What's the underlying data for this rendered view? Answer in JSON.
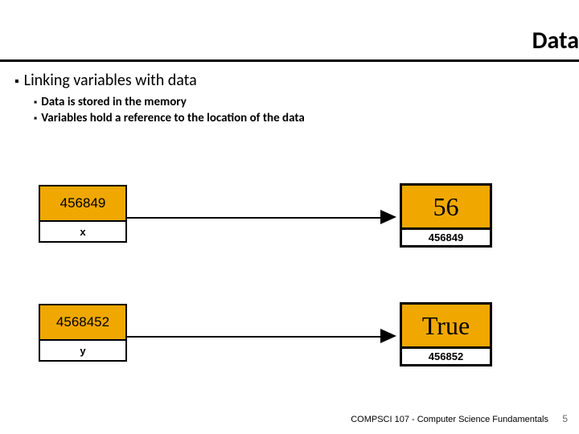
{
  "title": "Data",
  "bullets": {
    "main": "Linking variables with data",
    "sub1": "Data is stored in the memory",
    "sub2": "Variables hold a reference to the location of the data"
  },
  "var1": {
    "address": "456849",
    "name": "x"
  },
  "data1": {
    "value": "56",
    "addr": "456849"
  },
  "var2": {
    "address": "4568452",
    "name": "y"
  },
  "data2": {
    "value": "True",
    "addr": "456852"
  },
  "footer": {
    "course": "COMPSCI 107 - Computer Science Fundamentals",
    "page": "5"
  }
}
